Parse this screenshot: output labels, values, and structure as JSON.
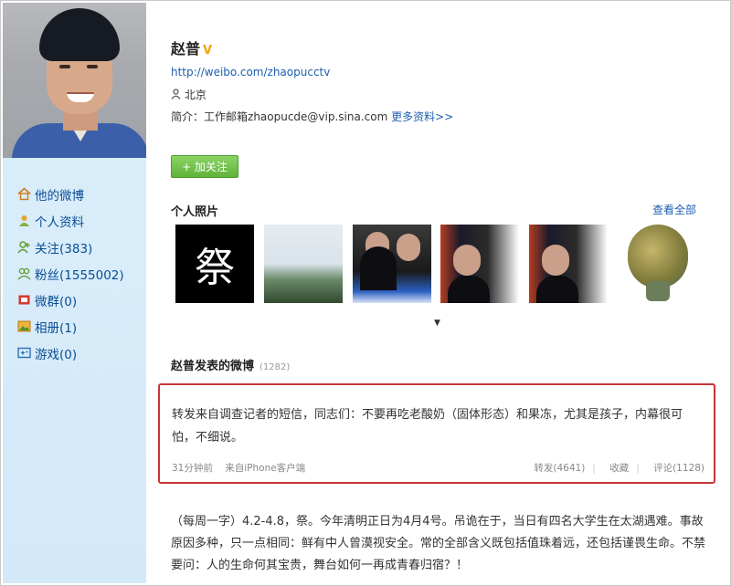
{
  "profile": {
    "name": "赵普",
    "verified_badge": "V",
    "url": "http://weibo.com/zhaopucctv",
    "location": "北京",
    "bio_label": "简介：",
    "bio_text": "工作邮箱zhaopucde@vip.sina.com",
    "bio_more": "更多资料>>",
    "follow_button": "+ 加关注"
  },
  "sidebar": {
    "items": [
      {
        "label": "他的微博",
        "icon": "home-icon"
      },
      {
        "label": "个人资料",
        "icon": "profile-icon"
      },
      {
        "label": "关注(383)",
        "icon": "follow-icon"
      },
      {
        "label": "粉丝(1555002)",
        "icon": "fans-icon"
      },
      {
        "label": "微群(0)",
        "icon": "group-icon"
      },
      {
        "label": "相册(1)",
        "icon": "album-icon"
      },
      {
        "label": "游戏(0)",
        "icon": "game-icon"
      }
    ]
  },
  "photos": {
    "title": "个人照片",
    "view_all": "查看全部",
    "first_photo_text": "祭"
  },
  "posts": {
    "title": "赵普发表的微博",
    "count": "(1282)",
    "featured": {
      "text": "转发来自调查记者的短信，同志们：不要再吃老酸奶（固体形态）和果冻，尤其是孩子，内幕很可怕，不细说。",
      "time": "31分钟前",
      "source": "来自iPhone客户端",
      "repost": "转发(4641)",
      "favorite": "收藏",
      "comment": "评论(1128)"
    },
    "second": {
      "text": "（每周一字）4.2-4.8，祭。今年清明正日为4月4号。吊诡在于，当日有四名大学生在太湖遇难。事故原因多种，只一点相同：鲜有中人曾漠视安全。常的全部含义既包括值珠着远，还包括谨畏生命。不禁要问：人的生命何其宝贵，舞台如何一再成青春归宿？！"
    }
  }
}
